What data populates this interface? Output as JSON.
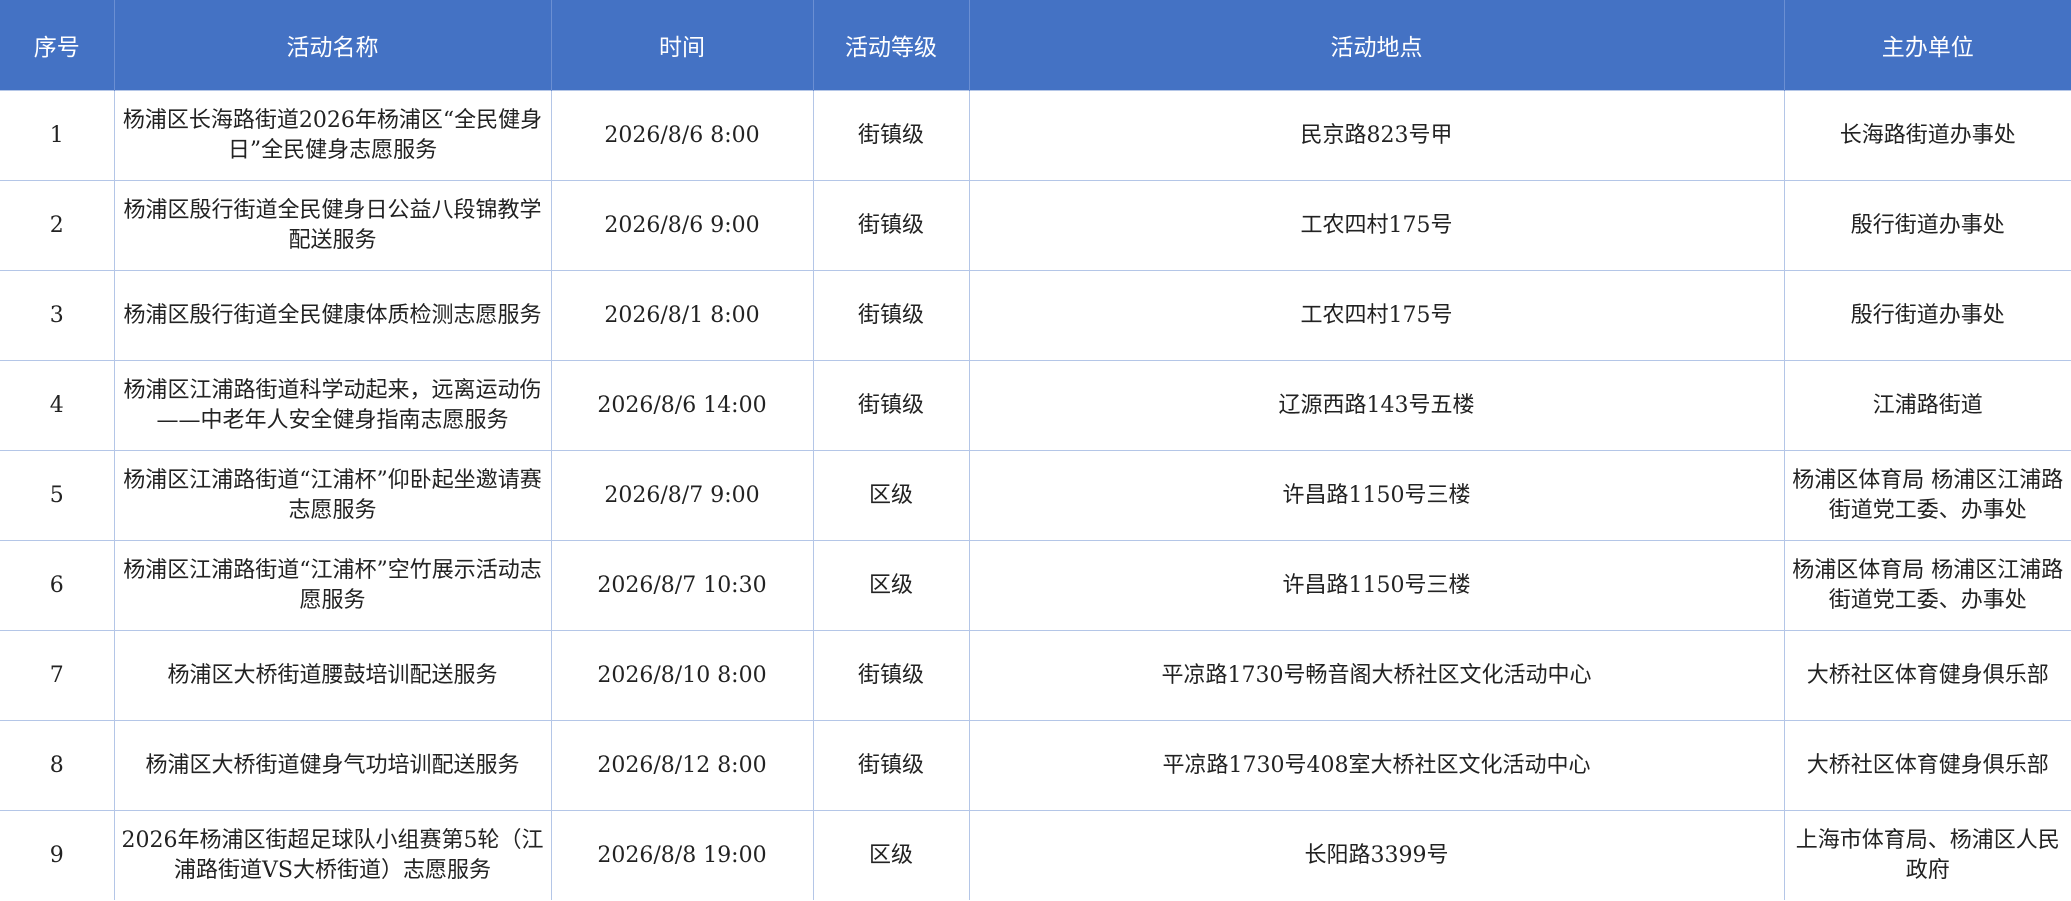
{
  "table": {
    "headers": [
      "序号",
      "活动名称",
      "时间",
      "活动等级",
      "活动地点",
      "主办单位"
    ],
    "rows": [
      [
        "1",
        "杨浦区长海路街道2026年杨浦区“全民健身日”全民健身志愿服务",
        "2026/8/6 8:00",
        "街镇级",
        "民京路823号甲",
        "长海路街道办事处"
      ],
      [
        "2",
        "杨浦区殷行街道全民健身日公益八段锦教学配送服务",
        "2026/8/6 9:00",
        "街镇级",
        "工农四村175号",
        "殷行街道办事处"
      ],
      [
        "3",
        "杨浦区殷行街道全民健康体质检测志愿服务",
        "2026/8/1 8:00",
        "街镇级",
        "工农四村175号",
        "殷行街道办事处"
      ],
      [
        "4",
        "杨浦区江浦路街道科学动起来，远离运动伤——中老年人安全健身指南志愿服务",
        "2026/8/6 14:00",
        "街镇级",
        "辽源西路143号五楼",
        "江浦路街道"
      ],
      [
        "5",
        "杨浦区江浦路街道“江浦杯”仰卧起坐邀请赛志愿服务",
        "2026/8/7 9:00",
        "区级",
        "许昌路1150号三楼",
        "杨浦区体育局 杨浦区江浦路街道党工委、办事处"
      ],
      [
        "6",
        "杨浦区江浦路街道“江浦杯”空竹展示活动志愿服务",
        "2026/8/7 10:30",
        "区级",
        "许昌路1150号三楼",
        "杨浦区体育局 杨浦区江浦路街道党工委、办事处"
      ],
      [
        "7",
        "杨浦区大桥街道腰鼓培训配送服务",
        "2026/8/10 8:00",
        "街镇级",
        "平凉路1730号畅音阁大桥社区文化活动中心",
        "大桥社区体育健身俱乐部"
      ],
      [
        "8",
        "杨浦区大桥街道健身气功培训配送服务",
        "2026/8/12 8:00",
        "街镇级",
        "平凉路1730号408室大桥社区文化活动中心",
        "大桥社区体育健身俱乐部"
      ],
      [
        "9",
        "2026年杨浦区街超足球队小组赛第5轮（江浦路街道VS大桥街道）志愿服务",
        "2026/8/8 19:00",
        "区级",
        "长阳路3399号",
        "上海市体育局、杨浦区人民政府"
      ]
    ]
  }
}
